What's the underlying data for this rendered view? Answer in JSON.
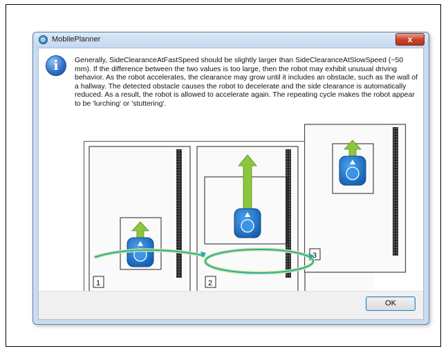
{
  "window": {
    "title": "MobilePlanner",
    "close_label": "x"
  },
  "message": {
    "text": "Generally, SideClearanceAtFastSpeed should be slightly larger than SideClearanceAtSlowSpeed (~50 mm). If the difference between the two values is too large, then the robot may exhibit unusual driving behavior. As the robot accelerates, the clearance may grow until it includes an obstacle, such as the wall of a hallway. The detected obstacle causes the robot to decelerate and the side clearance is automatically reduced. As a result, the robot is allowed to accelerate again. The repeating cycle makes the robot appear to be 'lurching' or 'stuttering'."
  },
  "figure": {
    "panels": [
      {
        "label": "1"
      },
      {
        "label": "2"
      },
      {
        "label": "3"
      }
    ],
    "colors": {
      "robot_blue": "#1f73c7",
      "arrow_green": "#8cc63f",
      "cycle_teal": "#2aa6b8",
      "wall_dark": "#3a3a3a"
    }
  },
  "buttons": {
    "ok_label": "OK"
  },
  "icons": {
    "info": "info-icon",
    "app": "mobileplanner-app-icon",
    "close": "close-icon"
  },
  "info_glyph": "i"
}
